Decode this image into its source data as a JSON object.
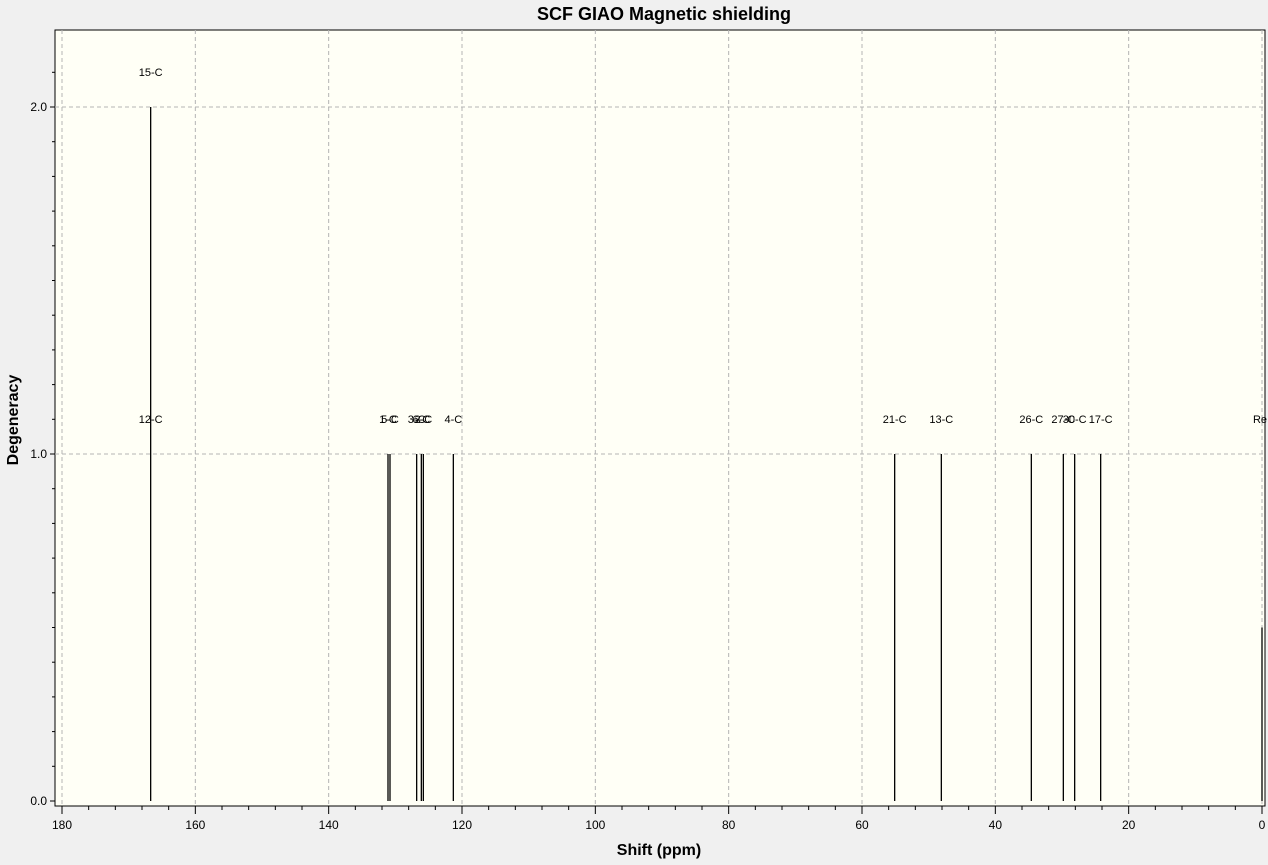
{
  "chart_data": {
    "type": "bar",
    "title": "SCF GIAO Magnetic shielding",
    "xlabel": "Shift (ppm)",
    "ylabel": "Degeneracy",
    "xlim": [
      180,
      0
    ],
    "ylim": [
      0,
      2.2
    ],
    "x_ticks": [
      180,
      160,
      140,
      120,
      100,
      80,
      60,
      40,
      20,
      0
    ],
    "x_tick_labels": [
      "180",
      "160",
      "140",
      "120",
      "100",
      "80",
      "60",
      "40",
      "20",
      "0"
    ],
    "y_ticks": [
      0,
      1,
      2
    ],
    "y_tick_labels": [
      "0.0",
      "1.0",
      "2.0"
    ],
    "grid": true,
    "colors": {
      "plot_bg": "#fffff6",
      "outer_bg": "#f0f0f0",
      "stick": "#000000",
      "grid": "#b4b4b4"
    },
    "peaks": [
      {
        "x": 166.7,
        "degeneracy": 2,
        "labels": [
          "12-C",
          "15-C"
        ]
      },
      {
        "x": 131.1,
        "degeneracy": 1,
        "labels": [
          "1-C"
        ]
      },
      {
        "x": 130.8,
        "degeneracy": 1,
        "labels": [
          "5-C"
        ]
      },
      {
        "x": 126.8,
        "degeneracy": 1,
        "labels": [
          "3-C"
        ]
      },
      {
        "x": 126.1,
        "degeneracy": 1,
        "labels": [
          "6-C"
        ]
      },
      {
        "x": 125.8,
        "degeneracy": 1,
        "labels": [
          "2-C"
        ]
      },
      {
        "x": 121.3,
        "degeneracy": 1,
        "labels": [
          "4-C"
        ]
      },
      {
        "x": 55.1,
        "degeneracy": 1,
        "labels": [
          "21-C"
        ]
      },
      {
        "x": 48.1,
        "degeneracy": 1,
        "labels": [
          "13-C"
        ]
      },
      {
        "x": 34.6,
        "degeneracy": 1,
        "labels": [
          "26-C"
        ]
      },
      {
        "x": 29.8,
        "degeneracy": 1,
        "labels": [
          "27-C"
        ]
      },
      {
        "x": 28.1,
        "degeneracy": 1,
        "labels": [
          "30-C"
        ]
      },
      {
        "x": 24.2,
        "degeneracy": 1,
        "labels": [
          "17-C"
        ]
      },
      {
        "x": 0.0,
        "degeneracy": 0.5,
        "labels": [
          "Re"
        ]
      }
    ]
  }
}
